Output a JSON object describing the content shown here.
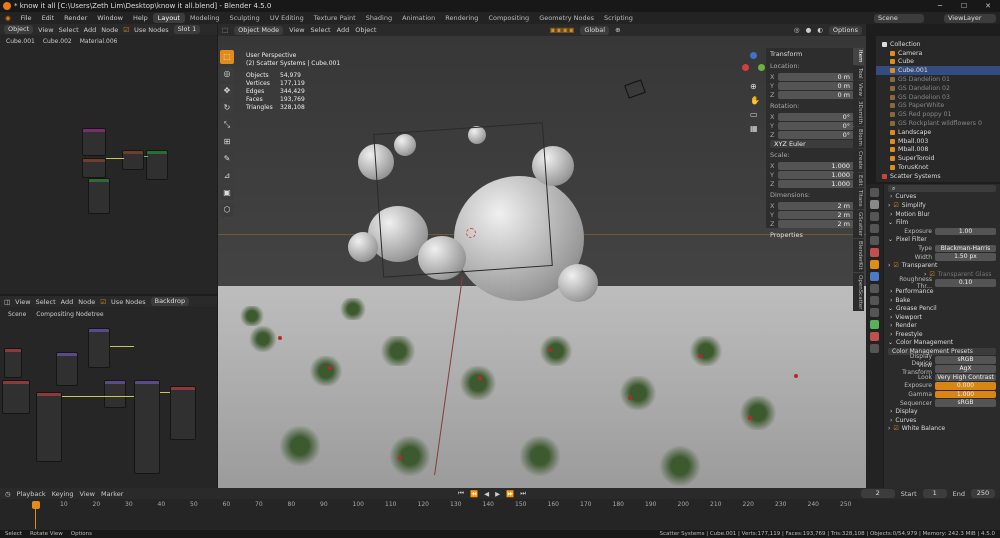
{
  "window": {
    "title": "* know it all [C:\\Users\\Zeth Lim\\Desktop\\know it all.blend] - Blender 4.5.0"
  },
  "menu": [
    "File",
    "Edit",
    "Render",
    "Window",
    "Help"
  ],
  "workspace_tabs": [
    "Layout",
    "Modeling",
    "Sculpting",
    "UV Editing",
    "Texture Paint",
    "Shading",
    "Animation",
    "Rendering",
    "Compositing",
    "Geometry Nodes",
    "Scripting"
  ],
  "scene": {
    "name": "Scene",
    "view_layer": "ViewLayer"
  },
  "shader_editor": {
    "mode": "Object",
    "menus": [
      "View",
      "Select",
      "Add",
      "Node"
    ],
    "use_nodes": "Use Nodes",
    "slot": "Slot 1",
    "breadcrumb": [
      "Cube.001",
      "Cube.002",
      "Material.006"
    ]
  },
  "compositor": {
    "menus": [
      "View",
      "Select",
      "Add",
      "Node"
    ],
    "use_nodes": "Use Nodes",
    "backdrop": "Backdrop",
    "breadcrumb": [
      "Scene",
      "Compositing Nodetree"
    ]
  },
  "viewport": {
    "mode": "Object Mode",
    "menus": [
      "View",
      "Select",
      "Add",
      "Object"
    ],
    "orientation": "Global",
    "options": "Options",
    "perspective": "User Perspective",
    "context": "(2) Scatter Systems | Cube.001",
    "stats": [
      {
        "k": "Objects",
        "v": "54,979"
      },
      {
        "k": "Vertices",
        "v": "177,119"
      },
      {
        "k": "Edges",
        "v": "344,429"
      },
      {
        "k": "Faces",
        "v": "193,769"
      },
      {
        "k": "Triangles",
        "v": "328,108"
      }
    ]
  },
  "transform": {
    "title": "Transform",
    "location_label": "Location:",
    "location": [
      {
        "l": "X",
        "v": "0 m"
      },
      {
        "l": "Y",
        "v": "0 m"
      },
      {
        "l": "Z",
        "v": "0 m"
      }
    ],
    "rotation_label": "Rotation:",
    "rotation": [
      {
        "l": "X",
        "v": "0°"
      },
      {
        "l": "Y",
        "v": "0°"
      },
      {
        "l": "Z",
        "v": "0°"
      }
    ],
    "rot_mode": "XYZ Euler",
    "scale_label": "Scale:",
    "scale": [
      {
        "l": "X",
        "v": "1.000"
      },
      {
        "l": "Y",
        "v": "1.000"
      },
      {
        "l": "Z",
        "v": "1.000"
      }
    ],
    "dim_label": "Dimensions:",
    "dimensions": [
      {
        "l": "X",
        "v": "2 m"
      },
      {
        "l": "Y",
        "v": "2 m"
      },
      {
        "l": "Z",
        "v": "2 m"
      }
    ],
    "properties": "Properties"
  },
  "side_tabs": [
    "Item",
    "Tool",
    "View",
    "3Dsmith",
    "Blosm",
    "Create",
    "Edit",
    "Titans",
    "GScatter",
    "BlenderKit",
    "OpenScatter"
  ],
  "outliner": {
    "root": "Collection",
    "items": [
      "Camera",
      "Cube",
      "Cube.001",
      "GS Dandelion 01",
      "GS Dandelion 02",
      "GS Dandelion 03",
      "GS PaperWhite",
      "GS Red poppy 01",
      "GS Rockplant wildflowers 0",
      "Landscape",
      "Mball.003",
      "Mball.008",
      "SuperToroid",
      "TorusKnot",
      "Scatter Systems"
    ]
  },
  "properties": {
    "rows": [
      {
        "t": "sec",
        "label": "Curves"
      },
      {
        "t": "chk",
        "label": "Simplify"
      },
      {
        "t": "sec",
        "label": "Motion Blur"
      },
      {
        "t": "head",
        "label": "Film"
      },
      {
        "t": "field",
        "label": "Exposure",
        "value": "1.00"
      },
      {
        "t": "head",
        "label": "Pixel Filter"
      },
      {
        "t": "field",
        "label": "Type",
        "value": "Blackman-Harris"
      },
      {
        "t": "field",
        "label": "Width",
        "value": "1.50 px"
      },
      {
        "t": "chk",
        "label": "Transparent"
      },
      {
        "t": "chk2",
        "label": "Transparent Glass"
      },
      {
        "t": "field",
        "label": "Roughness Thr...",
        "value": "0.10"
      },
      {
        "t": "sec",
        "label": "Performance"
      },
      {
        "t": "sec",
        "label": "Bake"
      },
      {
        "t": "head",
        "label": "Grease Pencil"
      },
      {
        "t": "sec",
        "label": "Viewport"
      },
      {
        "t": "sec",
        "label": "Render"
      },
      {
        "t": "sec",
        "label": "Freestyle"
      },
      {
        "t": "head",
        "label": "Color Management"
      },
      {
        "t": "drop",
        "label": "Color Management Presets"
      },
      {
        "t": "field",
        "label": "Display Device",
        "value": "sRGB"
      },
      {
        "t": "field",
        "label": "View Transform",
        "value": "AgX"
      },
      {
        "t": "field",
        "label": "Look",
        "value": "Very High Contrast"
      },
      {
        "t": "ofield",
        "label": "Exposure",
        "value": "0.000"
      },
      {
        "t": "ofield",
        "label": "Gamma",
        "value": "1.000"
      },
      {
        "t": "field",
        "label": "Sequencer",
        "value": "sRGB"
      },
      {
        "t": "sec",
        "label": "Display"
      },
      {
        "t": "sec",
        "label": "Curves"
      },
      {
        "t": "chk",
        "label": "White Balance"
      }
    ]
  },
  "timeline": {
    "menus": [
      "Playback",
      "Keying",
      "View",
      "Marker"
    ],
    "current": "2",
    "start_label": "Start",
    "start": "1",
    "end_label": "End",
    "end": "250",
    "ticks": [
      "2",
      "10",
      "20",
      "30",
      "40",
      "50",
      "60",
      "70",
      "80",
      "90",
      "100",
      "110",
      "120",
      "130",
      "140",
      "150",
      "160",
      "170",
      "180",
      "190",
      "200",
      "210",
      "220",
      "230",
      "240",
      "250"
    ]
  },
  "status": {
    "left": [
      "Select",
      "Rotate View",
      "Options"
    ],
    "right": "Scatter Systems | Cube.001 | Verts:177,119 | Faces:193,769 | Tris:328,108 | Objects:0/54,979 | Memory: 242.3 MiB | 4.5.0"
  },
  "colors": {
    "accent": "#e08b1a",
    "selection": "#334d80",
    "bg": "#1d1d1d"
  }
}
